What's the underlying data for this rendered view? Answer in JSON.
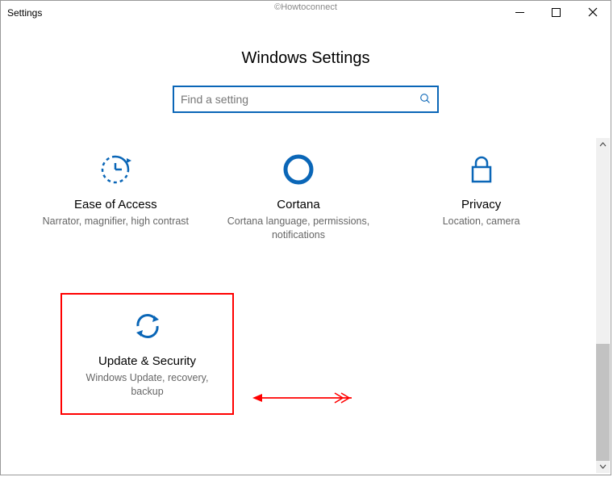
{
  "window": {
    "title": "Settings",
    "watermark": "©Howtoconnect"
  },
  "page": {
    "heading": "Windows Settings",
    "search_placeholder": "Find a setting"
  },
  "tiles": {
    "ease": {
      "label": "Ease of Access",
      "desc": "Narrator, magnifier, high contrast"
    },
    "cortana": {
      "label": "Cortana",
      "desc": "Cortana language, permissions, notifications"
    },
    "privacy": {
      "label": "Privacy",
      "desc": "Location, camera"
    },
    "update": {
      "label": "Update & Security",
      "desc": "Windows Update, recovery, backup"
    }
  }
}
